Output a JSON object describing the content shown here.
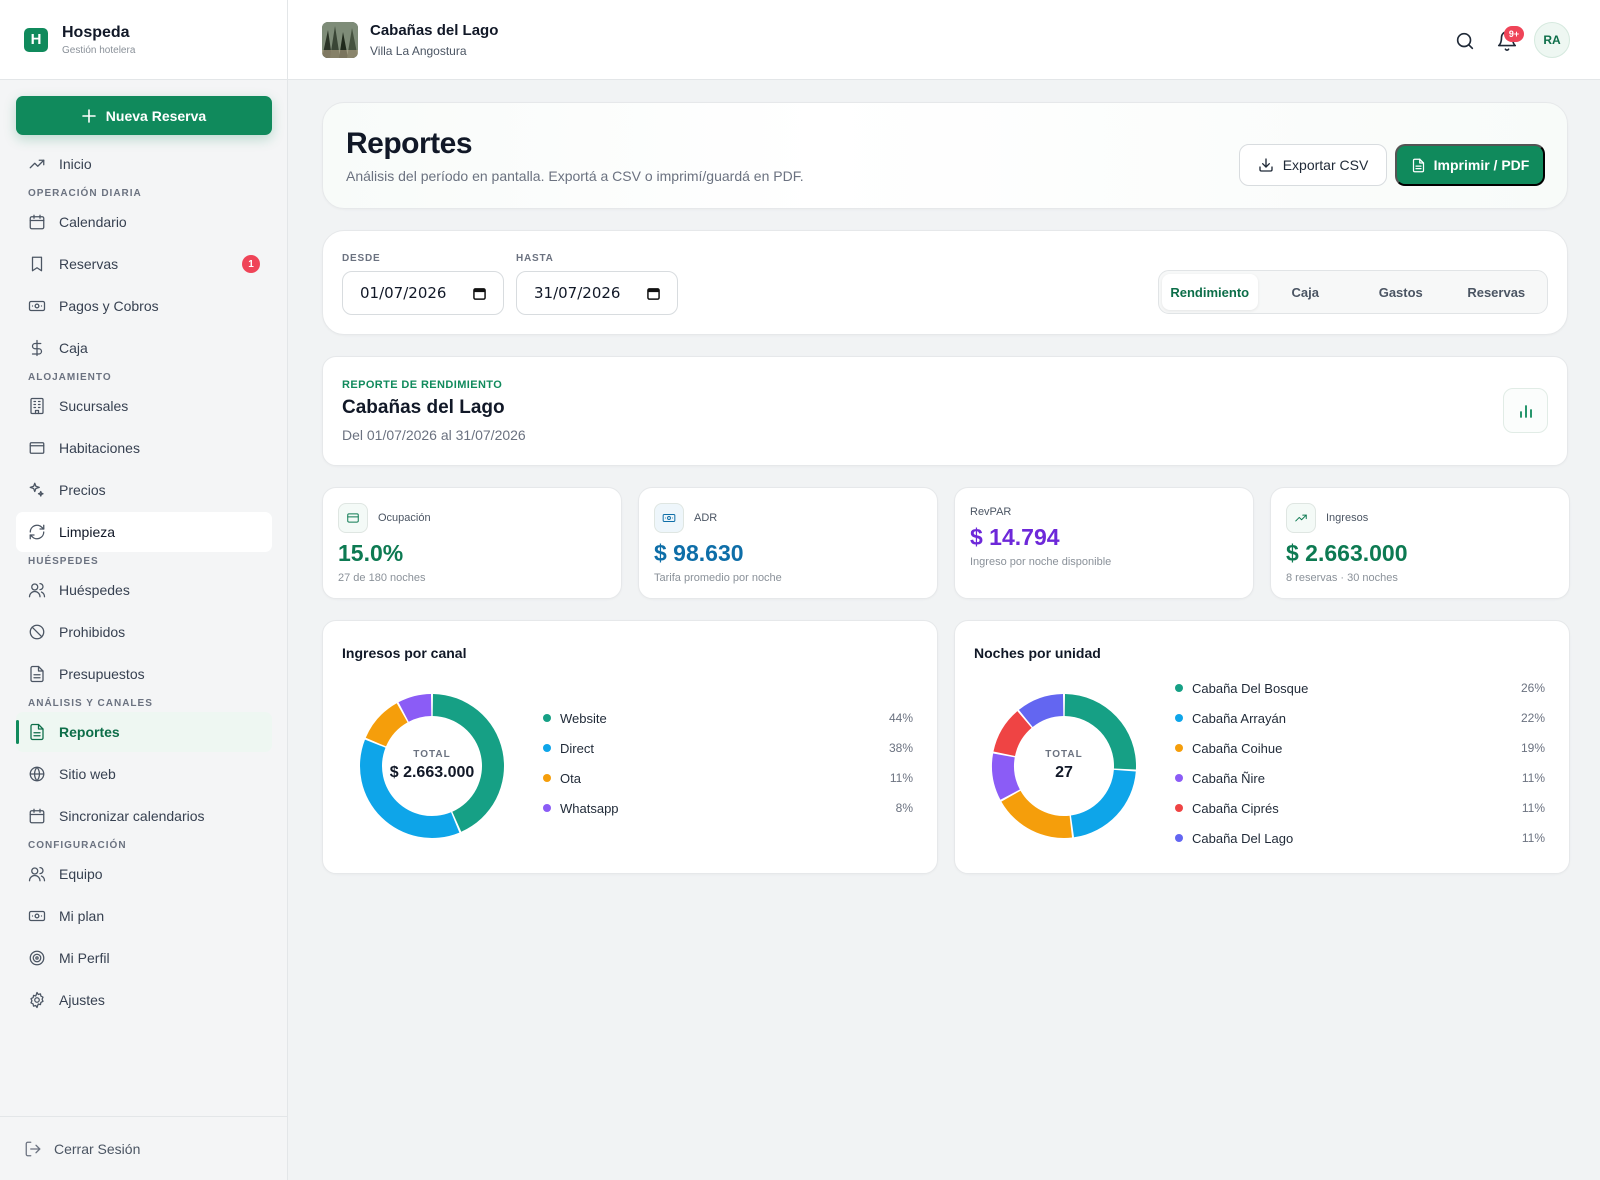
{
  "brand": {
    "name": "Hospeda",
    "subtitle": "Gestión hotelera",
    "logo_letter": "H"
  },
  "sidebar": {
    "new_button": "Nueva Reserva",
    "items": [
      {
        "type": "item",
        "label": "Inicio",
        "icon": "trending-up-icon"
      },
      {
        "type": "section",
        "label": "OPERACIÓN DIARIA"
      },
      {
        "type": "item",
        "label": "Calendario",
        "icon": "calendar-icon"
      },
      {
        "type": "item",
        "label": "Reservas",
        "icon": "bookmark-icon",
        "badge": "1"
      },
      {
        "type": "item",
        "label": "Pagos y Cobros",
        "icon": "banknote-icon"
      },
      {
        "type": "item",
        "label": "Caja",
        "icon": "dollar-icon"
      },
      {
        "type": "section",
        "label": "ALOJAMIENTO"
      },
      {
        "type": "item",
        "label": "Sucursales",
        "icon": "building-icon"
      },
      {
        "type": "item",
        "label": "Habitaciones",
        "icon": "bed-icon"
      },
      {
        "type": "item",
        "label": "Precios",
        "icon": "sparkles-icon"
      },
      {
        "type": "item",
        "label": "Limpieza",
        "icon": "refresh-icon",
        "state": "hover"
      },
      {
        "type": "section",
        "label": "HUÉSPEDES"
      },
      {
        "type": "item",
        "label": "Huéspedes",
        "icon": "users-icon"
      },
      {
        "type": "item",
        "label": "Prohibidos",
        "icon": "ban-icon"
      },
      {
        "type": "item",
        "label": "Presupuestos",
        "icon": "file-text-icon"
      },
      {
        "type": "section",
        "label": "ANÁLISIS Y CANALES"
      },
      {
        "type": "item",
        "label": "Reportes",
        "icon": "file-text-icon",
        "state": "active"
      },
      {
        "type": "item",
        "label": "Sitio web",
        "icon": "globe-icon"
      },
      {
        "type": "item",
        "label": "Sincronizar calendarios",
        "icon": "calendar-icon"
      },
      {
        "type": "section",
        "label": "CONFIGURACIÓN"
      },
      {
        "type": "item",
        "label": "Equipo",
        "icon": "users-icon"
      },
      {
        "type": "item",
        "label": "Mi plan",
        "icon": "banknote-icon"
      },
      {
        "type": "item",
        "label": "Mi Perfil",
        "icon": "target-icon"
      },
      {
        "type": "item",
        "label": "Ajustes",
        "icon": "gear-icon"
      }
    ],
    "logout": "Cerrar Sesión"
  },
  "topbar": {
    "property_name": "Cabañas del Lago",
    "property_location": "Villa La Angostura",
    "notifications_badge": "9+",
    "avatar_initials": "RA"
  },
  "header": {
    "title": "Reportes",
    "subtitle": "Análisis del período en pantalla. Exportá a CSV o imprimí/guardá en PDF.",
    "export_label": "Exportar CSV",
    "print_label": "Imprimir / PDF"
  },
  "filters": {
    "from_label": "DESDE",
    "from_value": "01/07/2026",
    "to_label": "HASTA",
    "to_value": "31/07/2026",
    "tabs": [
      "Rendimiento",
      "Caja",
      "Gastos",
      "Reservas"
    ],
    "active_tab": "Rendimiento"
  },
  "report": {
    "kicker": "REPORTE DE RENDIMIENTO",
    "title": "Cabañas del Lago",
    "range": "Del 01/07/2026 al 31/07/2026"
  },
  "kpis": [
    {
      "label": "Ocupación",
      "value": "15.0%",
      "note": "27 de 180 noches",
      "color": "#0d7a52",
      "icon": "card-icon"
    },
    {
      "label": "ADR",
      "value": "$ 98.630",
      "note": "Tarifa promedio por noche",
      "color": "#0e6ea8",
      "icon": "banknote-icon"
    },
    {
      "label": "RevPAR",
      "value": "$ 14.794",
      "note": "Ingreso por noche disponible",
      "color": "#6d28d9",
      "icon": ""
    },
    {
      "label": "Ingresos",
      "value": "$ 2.663.000",
      "note": "8 reservas · 30 noches",
      "color": "#0d7a52",
      "icon": "trending-up-icon"
    }
  ],
  "colors": {
    "accent": "#108a5c",
    "badge": "#ef4458"
  },
  "chart_data": [
    {
      "type": "pie",
      "title": "Ingresos por canal",
      "center_label": "TOTAL",
      "center_value": "$ 2.663.000",
      "categories": [
        "Website",
        "Direct",
        "Ota",
        "Whatsapp"
      ],
      "values": [
        44,
        38,
        11,
        8
      ],
      "labels": [
        "44%",
        "38%",
        "11%",
        "8%"
      ],
      "colors": [
        "#16a085",
        "#0ea5e9",
        "#f59e0b",
        "#8b5cf6"
      ]
    },
    {
      "type": "pie",
      "title": "Noches por unidad",
      "center_label": "TOTAL",
      "center_value": "27",
      "categories": [
        "Cabaña Del Bosque",
        "Cabaña Arrayán",
        "Cabaña Coihue",
        "Cabaña Ñire",
        "Cabaña Ciprés",
        "Cabaña Del Lago"
      ],
      "values": [
        26,
        22,
        19,
        11,
        11,
        11
      ],
      "labels": [
        "26%",
        "22%",
        "19%",
        "11%",
        "11%",
        "11%"
      ],
      "colors": [
        "#16a085",
        "#0ea5e9",
        "#f59e0b",
        "#8b5cf6",
        "#ef4444",
        "#6366f1"
      ]
    }
  ]
}
